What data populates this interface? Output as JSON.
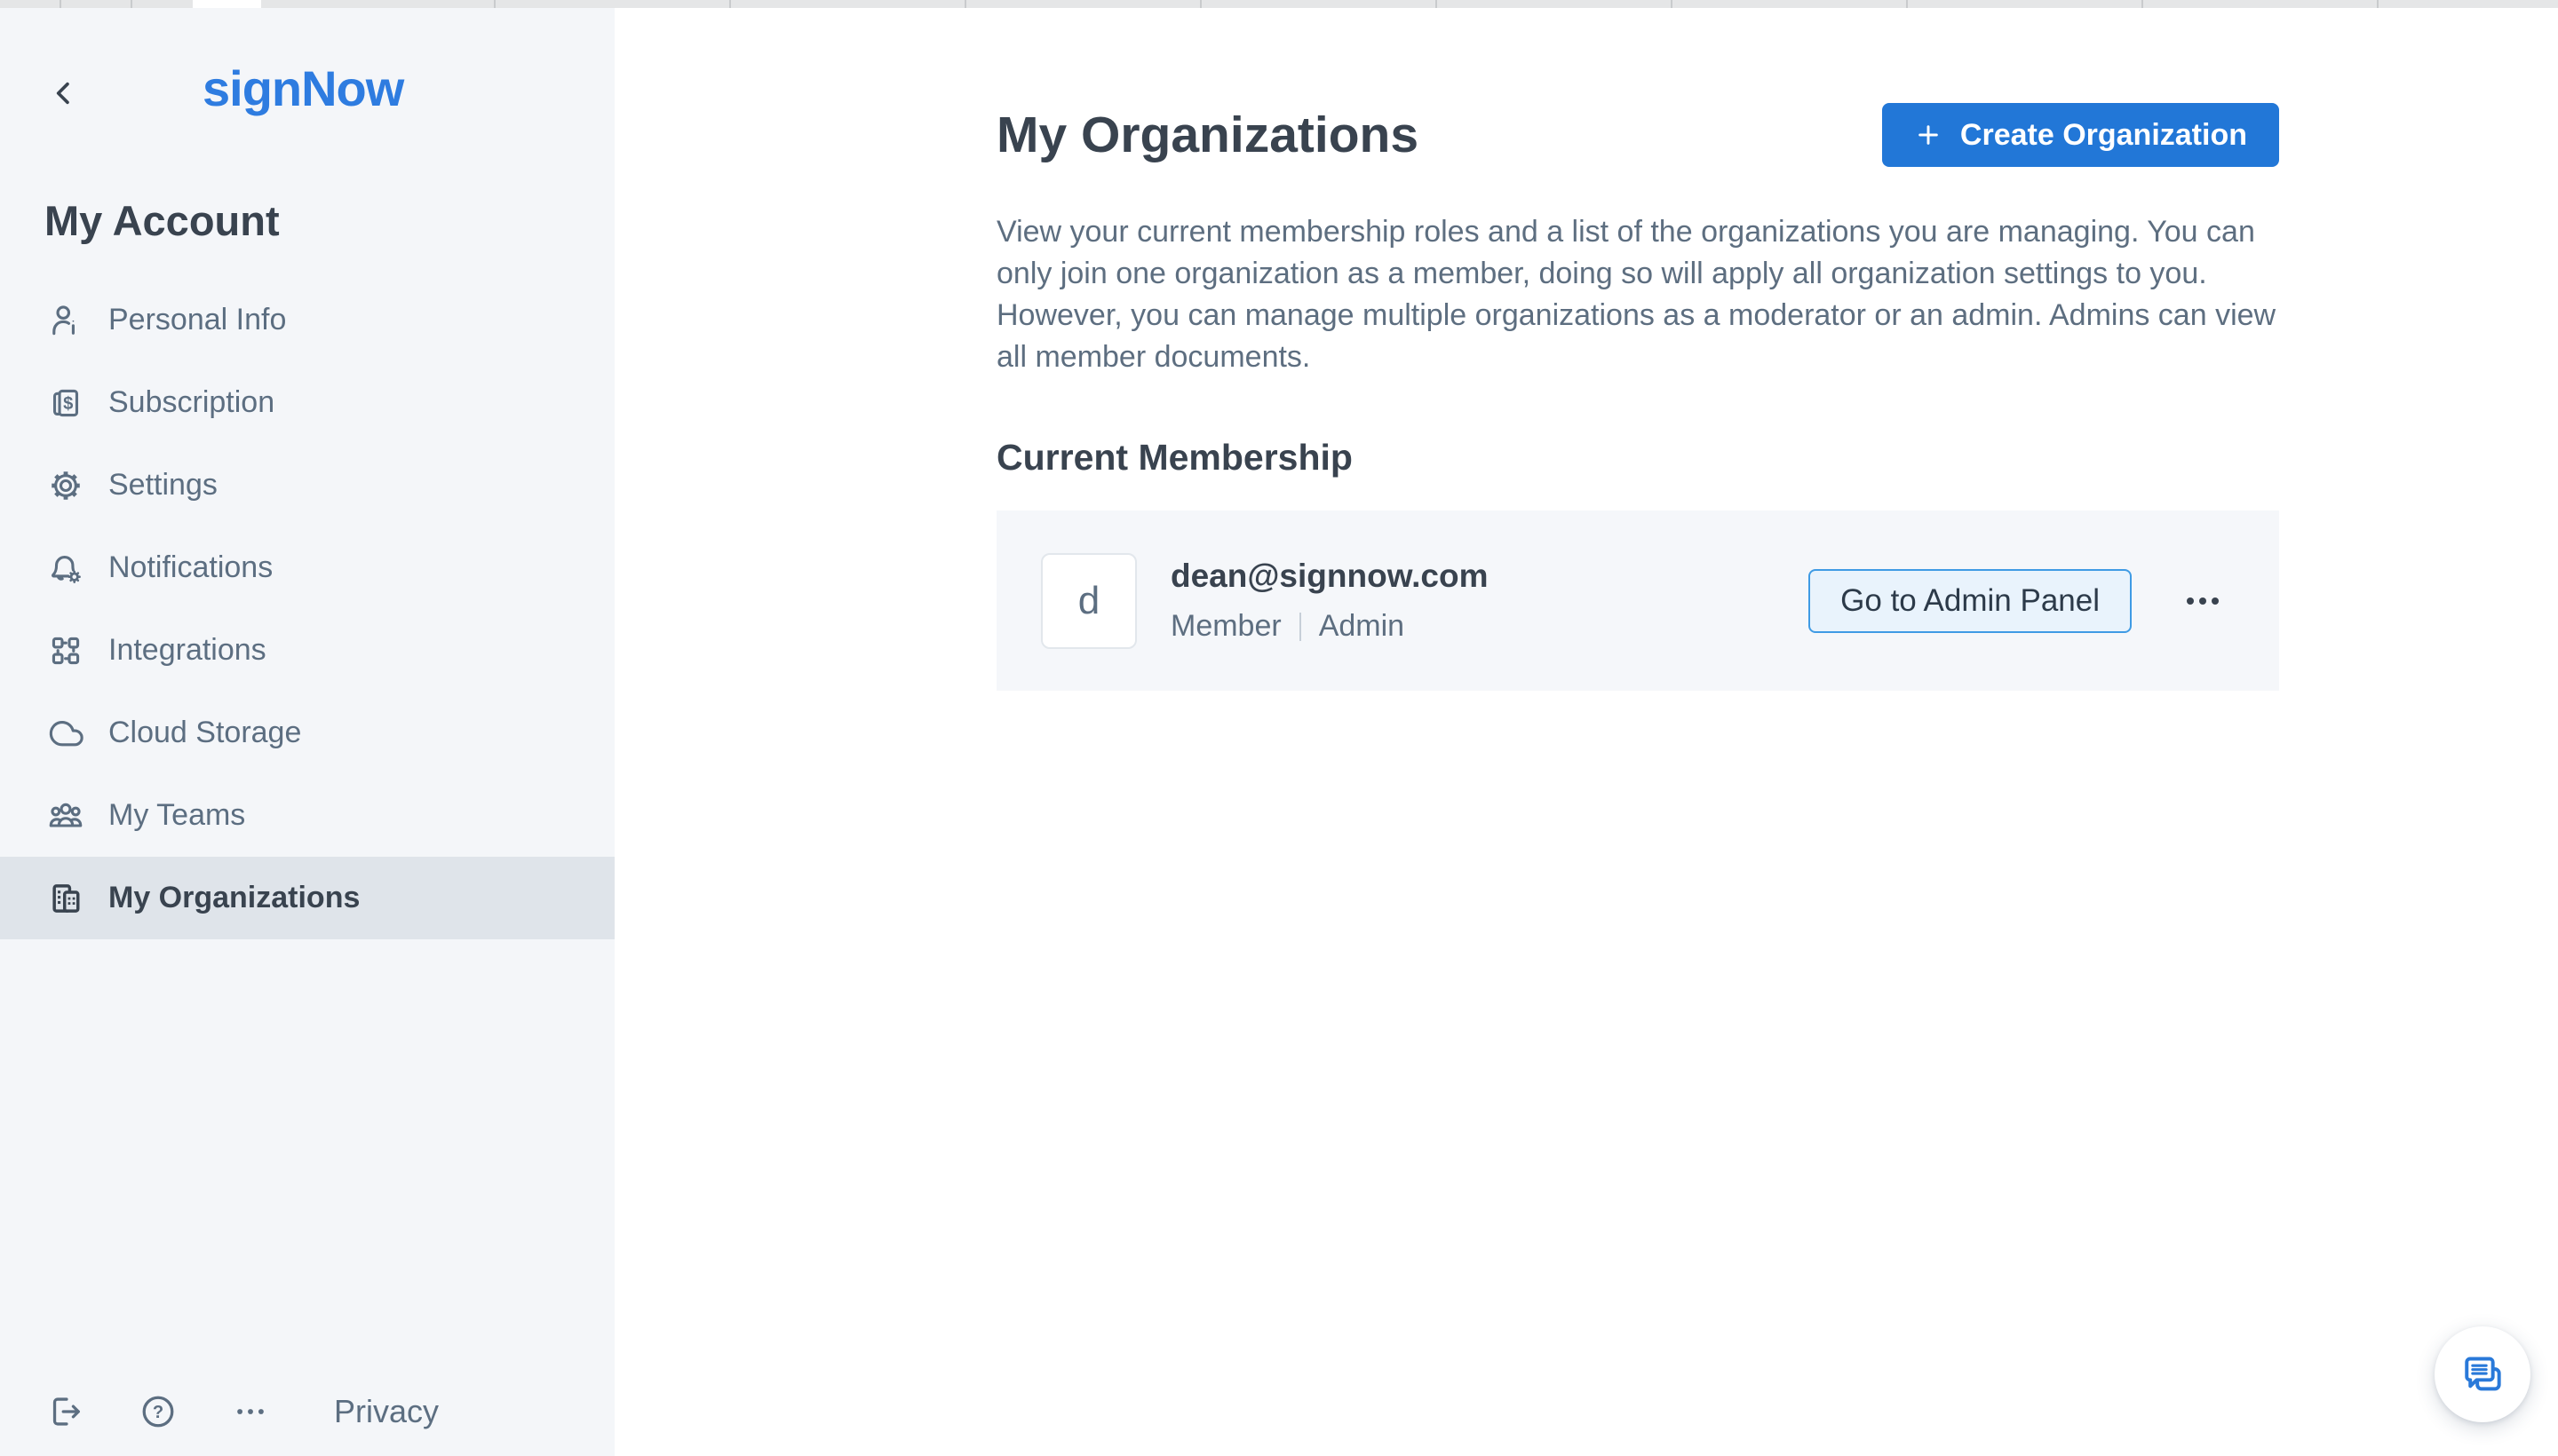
{
  "app": {
    "logo_text": "signNow"
  },
  "sidebar": {
    "heading": "My Account",
    "items": [
      {
        "label": "Personal Info",
        "icon": "person-info-icon",
        "active": false
      },
      {
        "label": "Subscription",
        "icon": "subscription-icon",
        "active": false
      },
      {
        "label": "Settings",
        "icon": "gear-icon",
        "active": false
      },
      {
        "label": "Notifications",
        "icon": "bell-gear-icon",
        "active": false
      },
      {
        "label": "Integrations",
        "icon": "integrations-icon",
        "active": false
      },
      {
        "label": "Cloud Storage",
        "icon": "cloud-icon",
        "active": false
      },
      {
        "label": "My Teams",
        "icon": "people-icon",
        "active": false
      },
      {
        "label": "My Organizations",
        "icon": "buildings-icon",
        "active": true
      }
    ],
    "footer": {
      "privacy_label": "Privacy",
      "icons": [
        "logout-icon",
        "help-icon",
        "more-dots-icon"
      ]
    }
  },
  "main": {
    "title": "My Organizations",
    "create_button_label": "Create Organization",
    "description": "View your current membership roles and a list of the organizations you are managing. You can only join one organization as a member, doing so will apply all organization settings to you. However, you can manage multiple organizations as a moderator or an admin. Admins can view all member documents.",
    "section_heading": "Current Membership",
    "membership": {
      "avatar_letter": "d",
      "email": "dean@signnow.com",
      "roles": [
        "Member",
        "Admin"
      ],
      "action_label": "Go to Admin Panel",
      "more_icon": "ellipsis-icon"
    }
  },
  "floating": {
    "chat_icon": "chat-bubbles-icon"
  },
  "colors": {
    "accent_blue": "#2277d7",
    "logo_blue": "#2e7ce0",
    "fab_icon_blue": "#2979d9",
    "sidebar_bg": "#f4f6f9",
    "active_item_bg": "#dfe4ea",
    "card_bg": "#f5f7fa",
    "dark_text": "#39434f",
    "muted_text": "#5d6e80",
    "admin_btn_bg": "#e9f3fc",
    "admin_btn_border": "#3f9be4"
  }
}
